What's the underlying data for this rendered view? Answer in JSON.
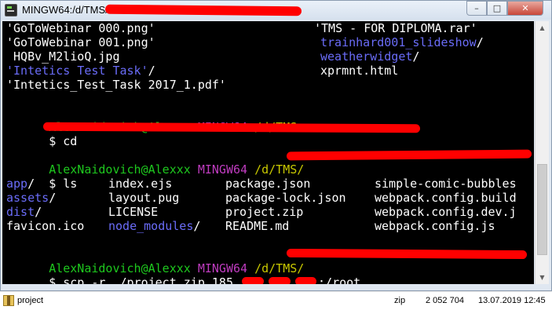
{
  "window": {
    "title": "MINGW64:/d/TMS/",
    "buttons": {
      "minimize": "–",
      "maximize": "□",
      "close": "✕"
    }
  },
  "terminal": {
    "listing1": [
      {
        "left": "'GoToWebinar 000.png'",
        "right": "'TMS - FOR DIPLOMA.rar'",
        "right_color": "white"
      },
      {
        "left": "'GoToWebinar 001.png'",
        "right": "trainhard001_slideshow",
        "right_suffix": "/",
        "right_color": "blue"
      },
      {
        "left": " HQBv_M2lioQ.jpg",
        "right": "weatherwidget",
        "right_suffix": "/",
        "right_color": "blue"
      },
      {
        "left": "'Intetics Test Task'",
        "left_suffix": "/",
        "left_color": "blue",
        "right": "xprmnt.html",
        "right_color": "white"
      },
      {
        "left": "'Intetics_Test_Task 2017_1.pdf'"
      }
    ],
    "prompt1": {
      "user": "AlexNaidovich@Alexxx",
      "shell": "MINGW64",
      "path": "/d/TMS"
    },
    "cmd1": "$ cd ",
    "prompt2": {
      "user": "AlexNaidovich@Alexxx",
      "shell": "MINGW64",
      "path": "/d/TMS/"
    },
    "cmd2": "$ ls",
    "listing2": [
      {
        "c1": "app",
        "c1s": "/",
        "c1b": true,
        "c2": "index.ejs",
        "c2s": "",
        "c2b": false,
        "c3": "package.json",
        "c4": "simple-comic-bubbles"
      },
      {
        "c1": "assets",
        "c1s": "/",
        "c1b": true,
        "c2": "layout.pug",
        "c2s": "",
        "c2b": false,
        "c3": "package-lock.json",
        "c4": "webpack.config.build"
      },
      {
        "c1": "dist",
        "c1s": "/",
        "c1b": true,
        "c2": "LICENSE",
        "c2s": "",
        "c2b": false,
        "c3": "project.zip",
        "c4": "webpack.config.dev.j"
      },
      {
        "c1": "favicon.ico",
        "c1s": "",
        "c1b": false,
        "c2": "node_modules",
        "c2s": "/",
        "c2b": true,
        "c3": "README.md",
        "c4": "webpack.config.js"
      }
    ],
    "prompt3": {
      "user": "AlexNaidovich@Alexxx",
      "shell": "MINGW64",
      "path": "/d/TMS/"
    },
    "cmd3_prefix": "$ scp -r ./project.zip 185.",
    "cmd3_suffix": ":/root"
  },
  "scrollbar": {
    "up_icon": "▲",
    "down_icon": "▼"
  },
  "file_row": {
    "name": "project",
    "type": "zip",
    "size": "2 052 704",
    "date": "13.07.2019 12:45"
  },
  "colors": {
    "terminal_bg": "#000000",
    "text": "#ffffff",
    "directory": "#6a6cf8",
    "prompt_user": "#1ec81e",
    "prompt_shell": "#c03cc0",
    "prompt_path": "#c8c800",
    "redaction": "#ff0000"
  }
}
